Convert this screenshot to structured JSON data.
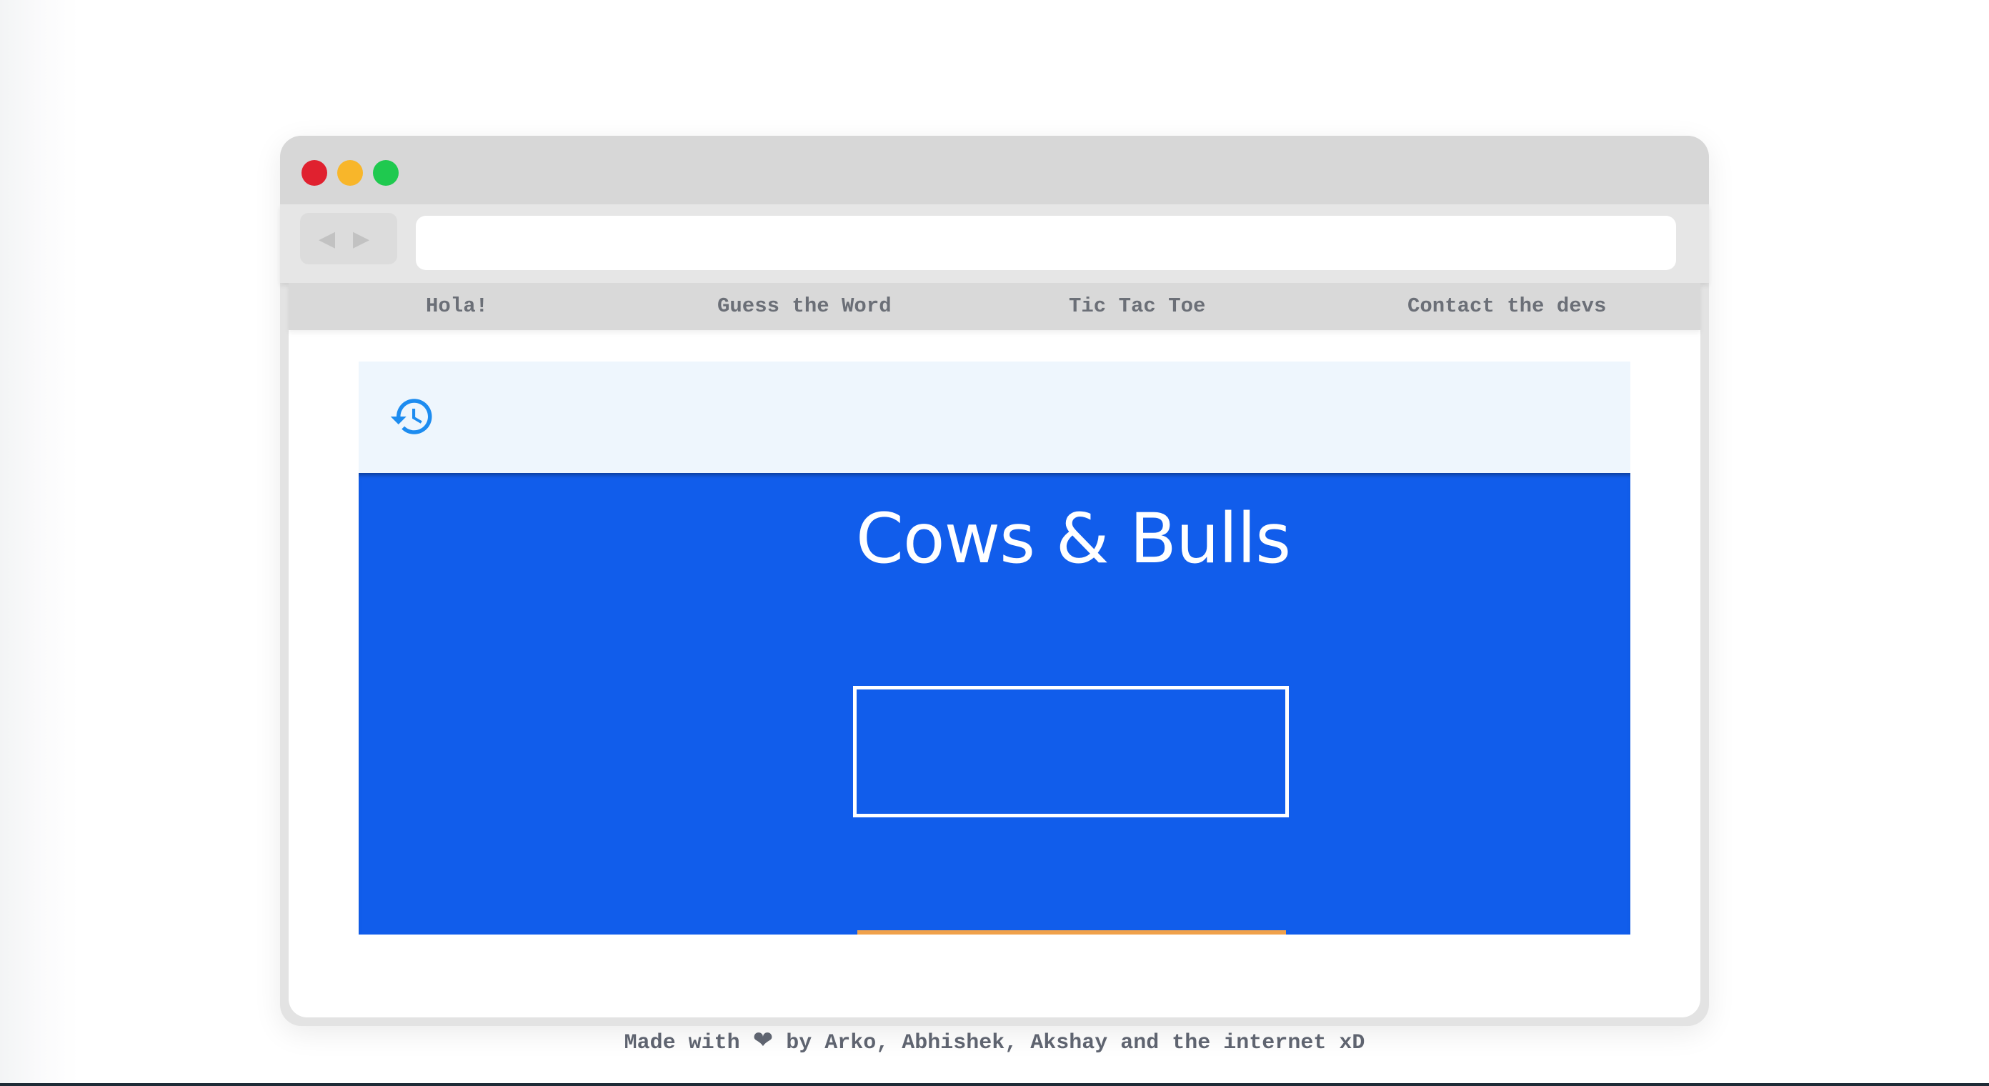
{
  "nav": {
    "links": [
      "Hola!",
      "Guess the Word",
      "Tic Tac Toe",
      "Contact the devs"
    ]
  },
  "game": {
    "title": "Cows & Bulls",
    "input_value": ""
  },
  "address_bar": {
    "value": ""
  },
  "footer": {
    "prefix": "Made with",
    "suffix": "by Arko, Abhishek, Akshay and the internet xD"
  },
  "icons": {
    "history": "history-icon",
    "heart": "heart-icon",
    "back": "back-arrow-icon",
    "forward": "forward-arrow-icon"
  },
  "colors": {
    "game_bg": "#115deb",
    "history_bar_bg": "#eef6fd",
    "icon_blue": "#1d8cf0",
    "accent_orange": "#f0a14a",
    "close_dot": "#e0212f",
    "minimize_dot": "#f8b62a",
    "maximize_dot": "#1fc94f"
  }
}
